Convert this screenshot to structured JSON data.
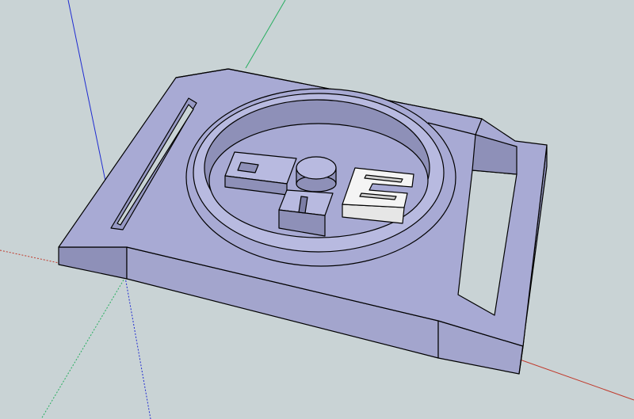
{
  "viewport": {
    "background": "#c9d3d5",
    "axes": {
      "red_axis_color": "#c0392b",
      "green_axis_color": "#27ae60",
      "blue_axis_color": "#1f2bd1"
    },
    "model": {
      "name": "buckle",
      "face_color": "#a8aad4",
      "light_face_color": "#c0c2e6",
      "shadow_face_color": "#8e90b8",
      "insert_color": "#f4f4f4"
    }
  }
}
